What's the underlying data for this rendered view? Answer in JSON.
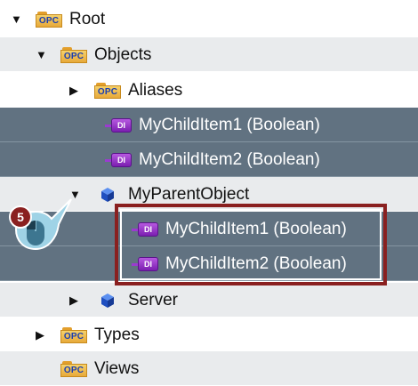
{
  "colors": {
    "selected_row_bg": "#617281",
    "alt_row_bg": "#e9ebed",
    "highlight_border": "#8a2020",
    "step_badge": "#8a2020",
    "opc_folder": "#f0c050",
    "di_tag": "#9b3bd0",
    "object_cube": "#1f5fd6"
  },
  "step_badge": "5",
  "tree": {
    "root": {
      "icon": "opc-folder-icon",
      "icon_text": "OPC",
      "label": "Root"
    },
    "objects": {
      "icon": "opc-folder-icon",
      "icon_text": "OPC",
      "label": "Objects"
    },
    "aliases": {
      "icon": "opc-folder-icon",
      "icon_text": "OPC",
      "label": "Aliases"
    },
    "child1": {
      "icon": "di-tag-icon",
      "icon_text": "DI",
      "label": "MyChildItem1 (Boolean)"
    },
    "child2": {
      "icon": "di-tag-icon",
      "icon_text": "DI",
      "label": "MyChildItem2 (Boolean)"
    },
    "parent": {
      "icon": "object-cube-icon",
      "label": "MyParentObject"
    },
    "parent_child1": {
      "icon": "di-tag-icon",
      "icon_text": "DI",
      "label": "MyChildItem1 (Boolean)"
    },
    "parent_child2": {
      "icon": "di-tag-icon",
      "icon_text": "DI",
      "label": "MyChildItem2 (Boolean)"
    },
    "server": {
      "icon": "object-cube-icon",
      "label": "Server"
    },
    "types": {
      "icon": "opc-folder-icon",
      "icon_text": "OPC",
      "label": "Types"
    },
    "views": {
      "icon": "opc-folder-icon",
      "icon_text": "OPC",
      "label": "Views"
    }
  }
}
